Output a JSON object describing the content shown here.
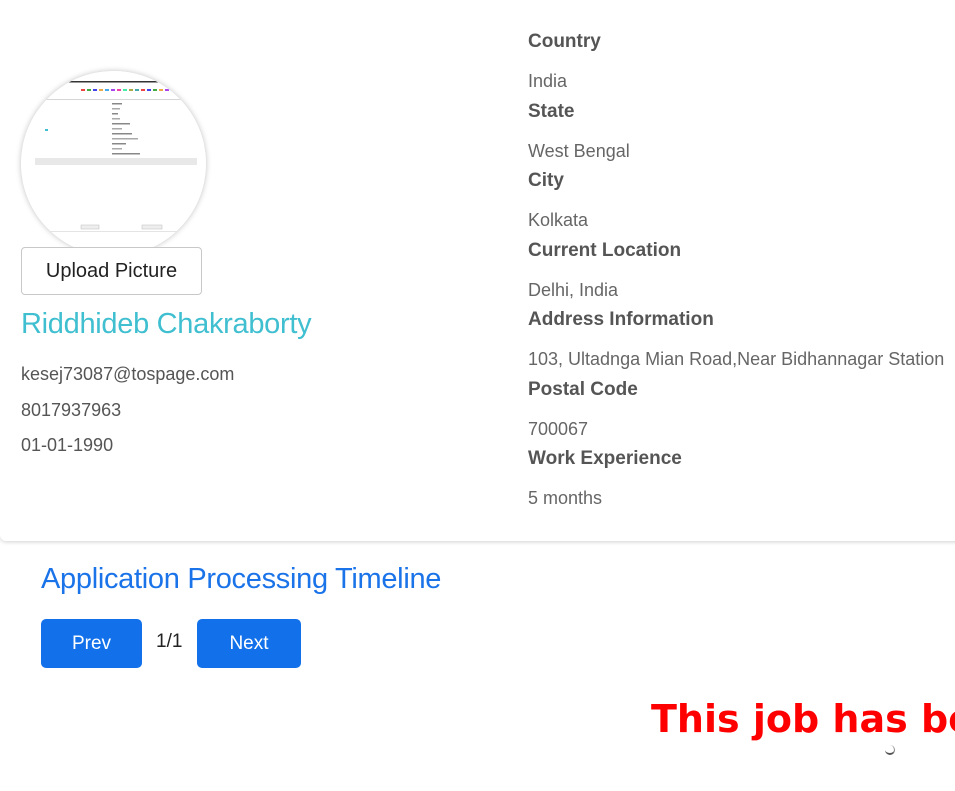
{
  "profile": {
    "upload_label": "Upload Picture",
    "name": "Riddhideb Chakraborty",
    "email": "kesej73087@tospage.com",
    "phone": "8017937963",
    "dob": "01-01-1990",
    "fields": [
      {
        "label": "Country",
        "value": "India"
      },
      {
        "label": "State",
        "value": "West Bengal"
      },
      {
        "label": "City",
        "value": "Kolkata"
      },
      {
        "label": "Current Location",
        "value": "Delhi, India"
      },
      {
        "label": "Address Information",
        "value": "103, Ultadnga Mian Road,Near Bidhannagar Station"
      },
      {
        "label": "Postal Code",
        "value": "700067"
      },
      {
        "label": "Work Experience",
        "value": "5 months"
      }
    ]
  },
  "timeline": {
    "title": "Application Processing Timeline",
    "prev_label": "Prev",
    "page_indicator": "1/1",
    "next_label": "Next"
  },
  "banner": {
    "text": "This job has been"
  },
  "colors": {
    "name": "#3fbfd0",
    "timeline_title": "#1a73e8",
    "button": "#1170ea",
    "banner": "#ff0000"
  }
}
